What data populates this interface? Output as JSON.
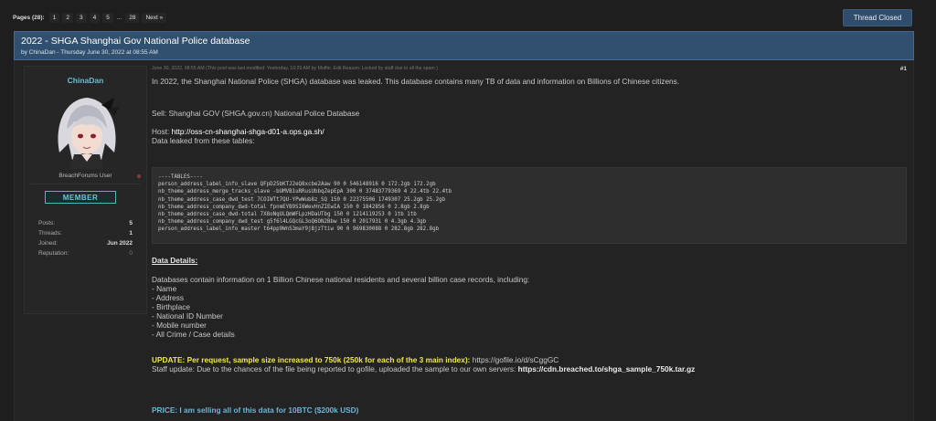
{
  "pagination": {
    "label": "Pages (28):",
    "pages": [
      "1",
      "2",
      "3",
      "4",
      "5"
    ],
    "ellipsis": "...",
    "last": "28",
    "next": "Next »"
  },
  "thread_status_button": "Thread Closed",
  "thread": {
    "title": "2022 - SHGA Shanghai Gov National Police database",
    "byline": "by ChinaDan - Thursday June 30, 2022 at 08:55 AM"
  },
  "user": {
    "name": "ChinaDan",
    "title": "BreachForums User",
    "badge": "MEMBER",
    "stats": [
      {
        "label": "Posts:",
        "value": "5"
      },
      {
        "label": "Threads:",
        "value": "1"
      },
      {
        "label": "Joined:",
        "value": "Jun 2022"
      },
      {
        "label": "Reputation:",
        "value": "0"
      }
    ]
  },
  "post": {
    "meta": "June 30, 2022, 08:55 AM  (This post was last modified: Yesterday, 10:29 AM by Muffin. Edit Reason: Locked by staff due to all the spam )",
    "number": "#1",
    "intro": "In 2022, the Shanghai National Police (SHGA) database was leaked. This database contains many TB of data and information on Billions of Chinese citizens.",
    "sell": "Sell: Shanghai GOV (SHGA.gov.cn) National Police Database",
    "host_label": "Host: ",
    "host_value": "http://oss-cn-shanghai-shga-d01-a.ops.ga.sh/",
    "tables_intro": "Data leaked from these tables:",
    "code_lines": [
      "----TABLES----",
      "person_address_label_info_slave QFpD25bKTJ2eQ8xcbe2Aaw 90 0 546148916 0 172.2gb 172.2gb",
      "nb_theme_address_merge_tracks_slave -bUMVB1uRRusUbbqZepEpA 300 0 37483779369 4 22.4tb 22.4tb",
      "nb_theme_address_case_dwd_test 7COIWTt7QU-YPwWub8z_SQ 150 0 22375506 1749307 25.2gb 25.2gb",
      "nb_theme_address_company_dwd-total fpnmEYB9SI6WevHnZIEwIA 150 0 1842856 0 2.8gb 2.8gb",
      "nb_theme_address_case_dwd-total 7X8oNqULQmWFLpzHDaUTbg 150 0 1214119253 0 1tb 1tb",
      "nb_theme_address_company_dwd_test g5f6l4LGQcGL3oQ6ON2Bbw 150 0 2017931 0 4.3gb 4.3gb",
      "person_address_label_info_master t64pp9WnS3maY9jBjzTtiw 90 0 969830088 0 282.8gb 282.8gb"
    ],
    "details_heading": "Data Details:",
    "details_intro": "Databases contain information on 1 Billion Chinese national residents and several billion case records, including:",
    "details_items": [
      "- Name",
      "- Address",
      "- Birthplace",
      "- National ID Number",
      "- Mobile number",
      "- All Crime / Case details"
    ],
    "update_bold": "UPDATE: Per request, sample size increased to 750k (250k for each of the 3 main index):",
    "update_link": " https://gofile.io/d/sCggGC",
    "staff_text": "Staff update: Due to the chances of the file being reported to gofile, uploaded the sample to our own servers: ",
    "staff_link": "https://cdn.breached.to/shga_sample_750k.tar.gz",
    "price": "PRICE: I am selling all of this data for 10BTC ($200k USD)"
  }
}
